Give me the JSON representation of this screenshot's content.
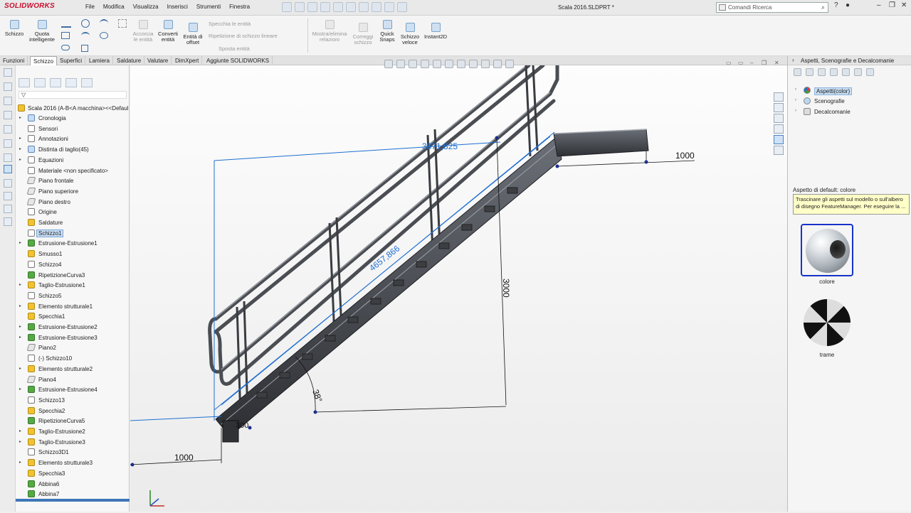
{
  "app": {
    "brand": "SOLIDWORKS",
    "document_title": "Scala 2016.SLDPRT *"
  },
  "menu": [
    "File",
    "Modifica",
    "Visualizza",
    "Inserisci",
    "Strumenti",
    "Finestra"
  ],
  "search": {
    "placeholder": "Comandi Ricerca"
  },
  "ribbon": {
    "schizzo": "Schizzo",
    "quota": "Quota intelligente",
    "accorcia": "Accorcia le entità",
    "converti": "Converti entità",
    "offset": "Entità di offset",
    "specchia": "Specchia le entità",
    "ripetizione": "Ripetizione di schizzo lineare",
    "sposta": "Sposta entità",
    "mostra": "Mostra/elimina relazioni",
    "correggi": "Correggi schizzo",
    "quicksnaps": "Quick Snaps",
    "schizzoveloce": "Schizzo veloce",
    "instant2d": "Instant2D"
  },
  "tabs": [
    "Funzioni",
    "Schizzo",
    "Superfici",
    "Lamiera",
    "Saldature",
    "Valutare",
    "DimXpert",
    "Aggiunte SOLIDWORKS"
  ],
  "active_tab": "Schizzo",
  "tree": {
    "root": "Scala 2016  (A-B<A macchina><<Defaul",
    "items": [
      {
        "label": "Cronologia",
        "icon": "history-icon",
        "expand": true
      },
      {
        "label": "Sensori",
        "icon": "sensor-icon",
        "expand": false
      },
      {
        "label": "Annotazioni",
        "icon": "annotation-icon",
        "expand": true
      },
      {
        "label": "Distinta di taglio(45)",
        "icon": "cutlist-icon",
        "expand": true
      },
      {
        "label": "Equazioni",
        "icon": "equation-icon",
        "expand": true
      },
      {
        "label": "Materiale <non specificato>",
        "icon": "material-icon",
        "expand": false
      },
      {
        "label": "Piano frontale",
        "icon": "plane-icon",
        "expand": false
      },
      {
        "label": "Piano superiore",
        "icon": "plane-icon",
        "expand": false
      },
      {
        "label": "Piano destro",
        "icon": "plane-icon",
        "expand": false
      },
      {
        "label": "Origine",
        "icon": "origin-icon",
        "expand": false
      },
      {
        "label": "Saldature",
        "icon": "weldment-icon",
        "expand": false
      },
      {
        "label": "Schizzo1",
        "icon": "sketch-icon",
        "expand": false,
        "selected": true
      },
      {
        "label": "Estrusione-Estrusione1",
        "icon": "extrude-icon",
        "expand": true
      },
      {
        "label": "Smusso1",
        "icon": "chamfer-icon",
        "expand": false
      },
      {
        "label": "Schizzo4",
        "icon": "sketch-icon",
        "expand": false
      },
      {
        "label": "RipetizioneCurva3",
        "icon": "pattern-icon",
        "expand": false
      },
      {
        "label": "Taglio-Estrusione1",
        "icon": "cut-icon",
        "expand": true
      },
      {
        "label": "Schizzo5",
        "icon": "sketch-icon",
        "expand": false
      },
      {
        "label": "Elemento strutturale1",
        "icon": "structural-member-icon",
        "expand": true
      },
      {
        "label": "Specchia1",
        "icon": "mirror-icon",
        "expand": false
      },
      {
        "label": "Estrusione-Estrusione2",
        "icon": "extrude-icon",
        "expand": true
      },
      {
        "label": "Estrusione-Estrusione3",
        "icon": "extrude-icon",
        "expand": true
      },
      {
        "label": "Piano2",
        "icon": "plane-icon",
        "expand": false
      },
      {
        "label": "(-) Schizzo10",
        "icon": "sketch-icon",
        "expand": false
      },
      {
        "label": "Elemento strutturale2",
        "icon": "structural-member-icon",
        "expand": true
      },
      {
        "label": "Piano4",
        "icon": "plane-icon",
        "expand": false
      },
      {
        "label": "Estrusione-Estrusione4",
        "icon": "extrude-icon",
        "expand": true
      },
      {
        "label": "Schizzo13",
        "icon": "sketch-icon",
        "expand": false
      },
      {
        "label": "Specchia2",
        "icon": "mirror-icon",
        "expand": false
      },
      {
        "label": "RipetizioneCurva5",
        "icon": "pattern-icon",
        "expand": false
      },
      {
        "label": "Taglio-Estrusione2",
        "icon": "cut-icon",
        "expand": true
      },
      {
        "label": "Taglio-Estrusione3",
        "icon": "cut-icon",
        "expand": true
      },
      {
        "label": "Schizzo3D1",
        "icon": "sketch3d-icon",
        "expand": false
      },
      {
        "label": "Elemento strutturale3",
        "icon": "structural-member-icon",
        "expand": true
      },
      {
        "label": "Specchia3",
        "icon": "mirror-icon",
        "expand": false
      },
      {
        "label": "Abbina6",
        "icon": "mate-icon",
        "expand": false
      },
      {
        "label": "Abbina7",
        "icon": "mate-icon",
        "expand": false
      }
    ]
  },
  "dimensions": {
    "top_length": "3871,825",
    "diagonal": "4657,866",
    "top_right": "1000",
    "height": "3000",
    "angle": "38°",
    "bottom_left": "1000",
    "bottom_small": "300"
  },
  "taskpane": {
    "title": "Aspetti, Scenografie e Decalcomanie",
    "items": [
      {
        "label": "Aspetti(color)",
        "selected": true
      },
      {
        "label": "Scenografie",
        "selected": false
      },
      {
        "label": "Decalcomanie",
        "selected": false
      }
    ],
    "default_label": "Aspetto di default: colore",
    "tooltip": "Trascinare gli aspetti sul modello o sull'albero di disegno FeatureManager. Per eseguire la ...",
    "thumbs": [
      {
        "label": "colore"
      },
      {
        "label": "trame"
      }
    ]
  },
  "colors": {
    "accent": "#1f6fd1",
    "selection": "#c7ddf3",
    "brand": "#c8102e",
    "dimension": "#1f6fd1"
  }
}
